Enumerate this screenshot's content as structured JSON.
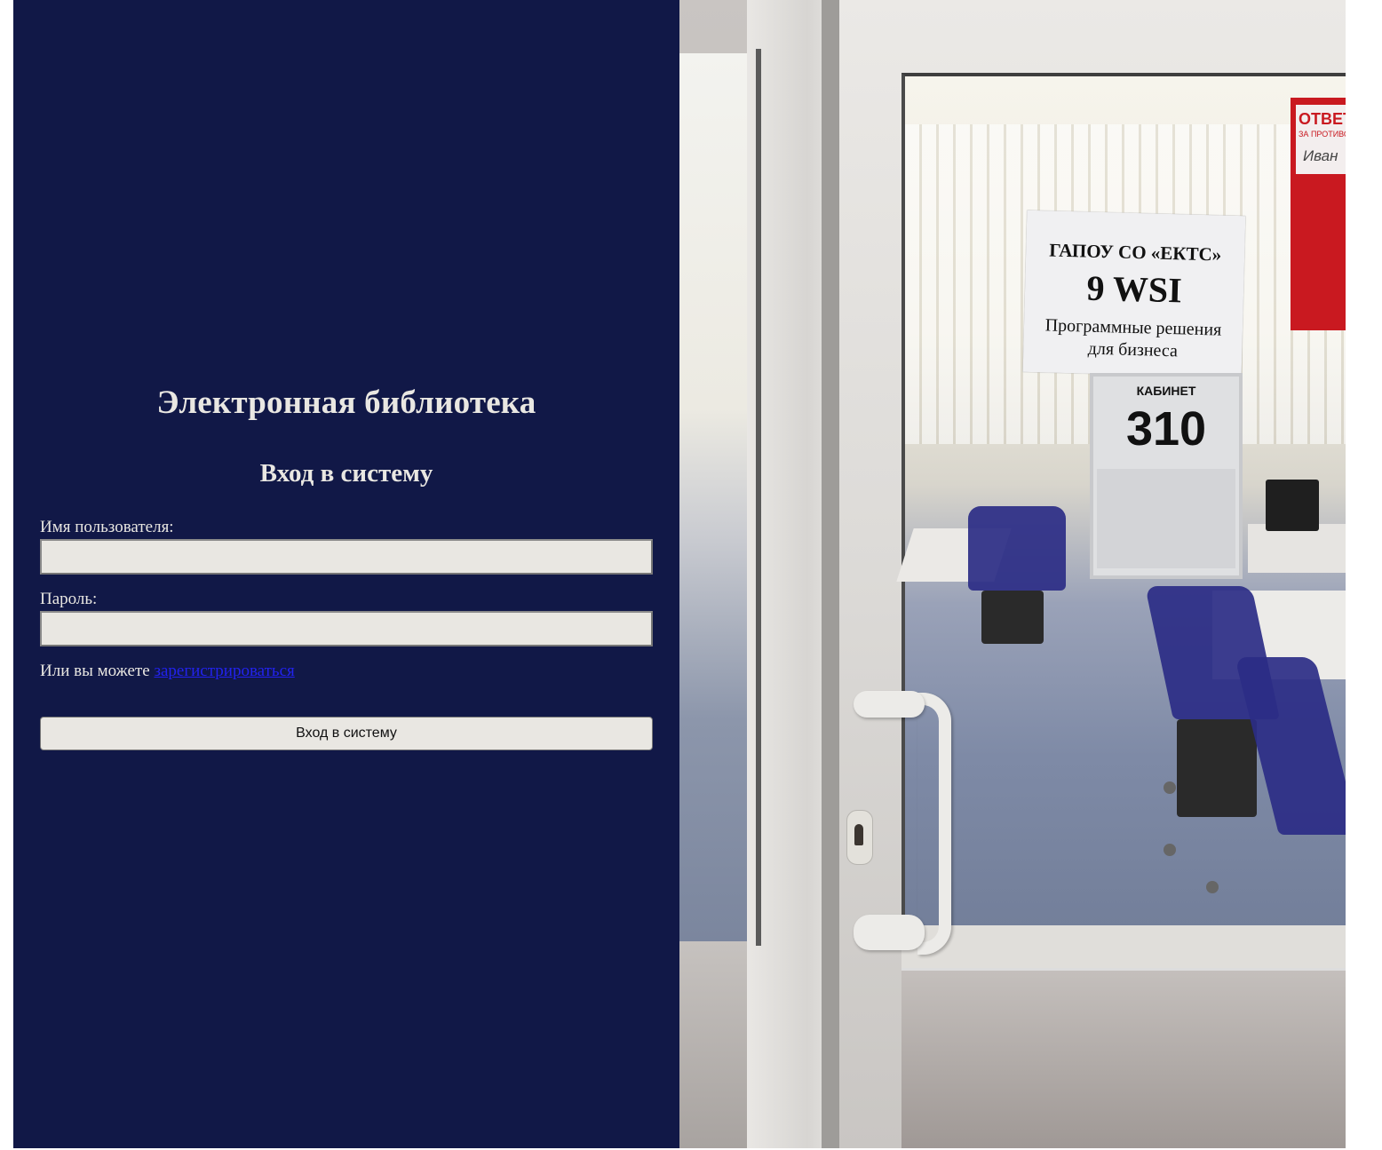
{
  "app": {
    "title": "Электронная библиотека",
    "subtitle": "Вход в систему"
  },
  "form": {
    "username_label": "Имя пользователя:",
    "username_value": "",
    "password_label": "Пароль:",
    "password_value": "",
    "register_prefix": "Или вы можете",
    "register_link": "зарегистрироваться",
    "submit_label": "Вход в систему"
  },
  "photo": {
    "sign_line1": "ГАПОУ СО «ЕКТС»",
    "sign_line2": "9 WSI",
    "sign_line3": "Программные решения",
    "sign_line4": "для бизнеса",
    "room_label": "КАБИНЕТ",
    "room_number": "310",
    "red_sign_text1": "ОТВЕТ",
    "red_sign_text2": "ЗА ПРОТИВОП",
    "red_sign_text3": "Иван"
  },
  "colors": {
    "panel_background": "#111847",
    "panel_text": "#e9e7e2",
    "input_background": "#e9e7e2",
    "link": "#2222ee"
  }
}
